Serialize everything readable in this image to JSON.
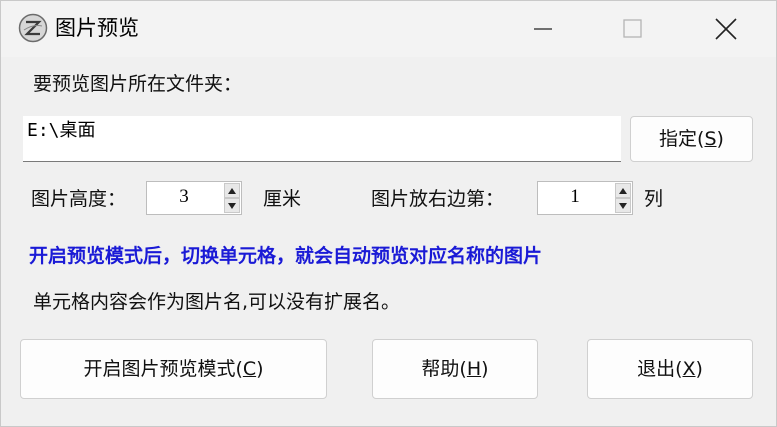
{
  "window": {
    "title": "图片预览"
  },
  "title_icon": "zinc-logo-icon",
  "labels": {
    "folder_prompt": "要预览图片所在文件夹：",
    "height": "图片高度：",
    "height_unit": "厘米",
    "column": "图片放右边第：",
    "column_unit": "列",
    "notice": "开启预览模式后，切换单元格，就会自动预览对应名称的图片",
    "hint": "单元格内容会作为图片名,可以没有扩展名。"
  },
  "folder_path": "E:\\桌面",
  "specify_button": {
    "text": "指定(",
    "mnemonic": "S",
    "end": ")"
  },
  "height_value": "3",
  "column_value": "1",
  "buttons": {
    "preview": {
      "text": "开启图片预览模式(",
      "mnemonic": "C",
      "end": ")"
    },
    "help": {
      "text": "帮助(",
      "mnemonic": "H",
      "end": ")"
    },
    "exit": {
      "text": "退出(",
      "mnemonic": "X",
      "end": ")"
    }
  },
  "colors": {
    "notice": "#1a1ad6",
    "background": "#f0f0f0"
  }
}
